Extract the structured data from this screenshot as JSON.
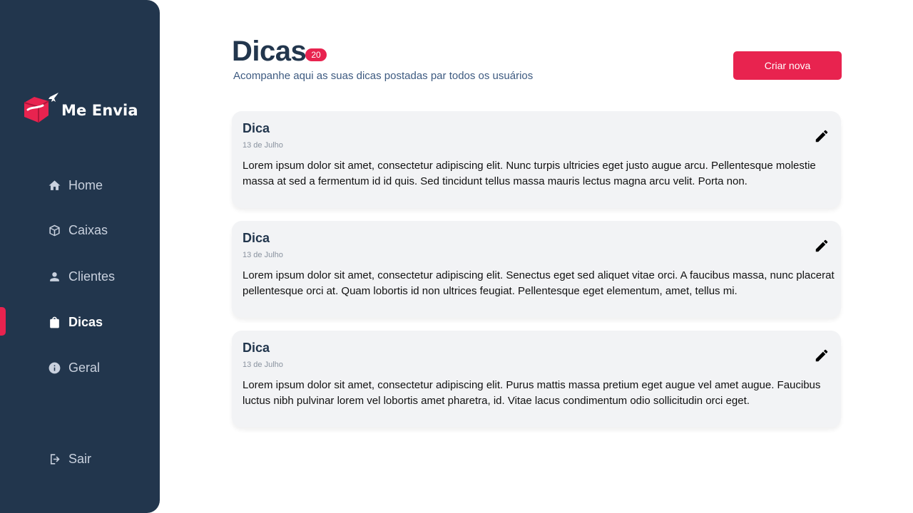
{
  "brand": {
    "name": "Me Envia",
    "accent": "#e8234f",
    "sidebar_bg": "#22364d"
  },
  "sidebar": {
    "items": [
      {
        "label": "Home",
        "icon": "home-icon"
      },
      {
        "label": "Caixas",
        "icon": "box-icon"
      },
      {
        "label": "Clientes",
        "icon": "user-icon"
      },
      {
        "label": "Dicas",
        "icon": "shopping-bag-icon",
        "active": true
      },
      {
        "label": "Geral",
        "icon": "info-icon"
      }
    ],
    "logout": {
      "label": "Sair",
      "icon": "logout-icon"
    }
  },
  "header": {
    "title": "Dicas",
    "count": "20",
    "subtitle": "Acompanhe aqui as suas dicas postadas par todos os usuários",
    "create_label": "Criar nova"
  },
  "tips": [
    {
      "title": "Dica",
      "date": "13 de Julho",
      "text": "Lorem ipsum dolor sit amet, consectetur adipiscing elit. Nunc turpis ultricies eget justo augue arcu. Pellentesque molestie massa at sed a fermentum id id quis. Sed tincidunt tellus massa mauris lectus magna arcu velit. Porta non."
    },
    {
      "title": "Dica",
      "date": "13 de Julho",
      "text": "Lorem ipsum dolor sit amet, consectetur adipiscing elit. Senectus eget sed aliquet vitae orci. A faucibus massa, nunc placerat pellentesque orci at. Quam lobortis id non ultrices feugiat. Pellentesque eget elementum, amet, tellus mi."
    },
    {
      "title": "Dica",
      "date": "13 de Julho",
      "text": "Lorem ipsum dolor sit amet, consectetur adipiscing elit. Purus mattis massa pretium eget augue vel amet augue. Faucibus luctus nibh pulvinar lorem vel lobortis amet pharetra, id. Vitae lacus condimentum odio sollicitudin orci eget."
    }
  ]
}
